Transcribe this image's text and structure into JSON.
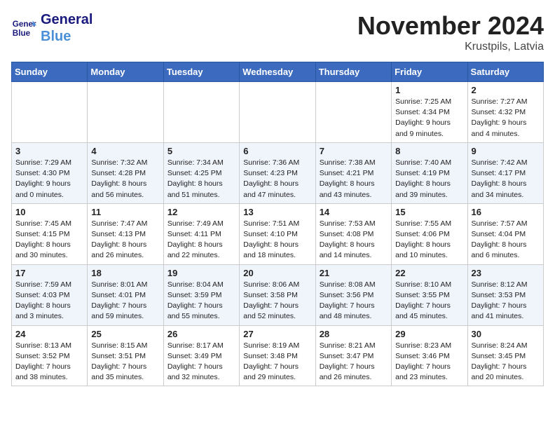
{
  "logo": {
    "line1": "General",
    "line2": "Blue"
  },
  "title": "November 2024",
  "location": "Krustpils, Latvia",
  "weekdays": [
    "Sunday",
    "Monday",
    "Tuesday",
    "Wednesday",
    "Thursday",
    "Friday",
    "Saturday"
  ],
  "rows": [
    [
      {
        "day": "",
        "info": ""
      },
      {
        "day": "",
        "info": ""
      },
      {
        "day": "",
        "info": ""
      },
      {
        "day": "",
        "info": ""
      },
      {
        "day": "",
        "info": ""
      },
      {
        "day": "1",
        "info": "Sunrise: 7:25 AM\nSunset: 4:34 PM\nDaylight: 9 hours and 9 minutes."
      },
      {
        "day": "2",
        "info": "Sunrise: 7:27 AM\nSunset: 4:32 PM\nDaylight: 9 hours and 4 minutes."
      }
    ],
    [
      {
        "day": "3",
        "info": "Sunrise: 7:29 AM\nSunset: 4:30 PM\nDaylight: 9 hours and 0 minutes."
      },
      {
        "day": "4",
        "info": "Sunrise: 7:32 AM\nSunset: 4:28 PM\nDaylight: 8 hours and 56 minutes."
      },
      {
        "day": "5",
        "info": "Sunrise: 7:34 AM\nSunset: 4:25 PM\nDaylight: 8 hours and 51 minutes."
      },
      {
        "day": "6",
        "info": "Sunrise: 7:36 AM\nSunset: 4:23 PM\nDaylight: 8 hours and 47 minutes."
      },
      {
        "day": "7",
        "info": "Sunrise: 7:38 AM\nSunset: 4:21 PM\nDaylight: 8 hours and 43 minutes."
      },
      {
        "day": "8",
        "info": "Sunrise: 7:40 AM\nSunset: 4:19 PM\nDaylight: 8 hours and 39 minutes."
      },
      {
        "day": "9",
        "info": "Sunrise: 7:42 AM\nSunset: 4:17 PM\nDaylight: 8 hours and 34 minutes."
      }
    ],
    [
      {
        "day": "10",
        "info": "Sunrise: 7:45 AM\nSunset: 4:15 PM\nDaylight: 8 hours and 30 minutes."
      },
      {
        "day": "11",
        "info": "Sunrise: 7:47 AM\nSunset: 4:13 PM\nDaylight: 8 hours and 26 minutes."
      },
      {
        "day": "12",
        "info": "Sunrise: 7:49 AM\nSunset: 4:11 PM\nDaylight: 8 hours and 22 minutes."
      },
      {
        "day": "13",
        "info": "Sunrise: 7:51 AM\nSunset: 4:10 PM\nDaylight: 8 hours and 18 minutes."
      },
      {
        "day": "14",
        "info": "Sunrise: 7:53 AM\nSunset: 4:08 PM\nDaylight: 8 hours and 14 minutes."
      },
      {
        "day": "15",
        "info": "Sunrise: 7:55 AM\nSunset: 4:06 PM\nDaylight: 8 hours and 10 minutes."
      },
      {
        "day": "16",
        "info": "Sunrise: 7:57 AM\nSunset: 4:04 PM\nDaylight: 8 hours and 6 minutes."
      }
    ],
    [
      {
        "day": "17",
        "info": "Sunrise: 7:59 AM\nSunset: 4:03 PM\nDaylight: 8 hours and 3 minutes."
      },
      {
        "day": "18",
        "info": "Sunrise: 8:01 AM\nSunset: 4:01 PM\nDaylight: 7 hours and 59 minutes."
      },
      {
        "day": "19",
        "info": "Sunrise: 8:04 AM\nSunset: 3:59 PM\nDaylight: 7 hours and 55 minutes."
      },
      {
        "day": "20",
        "info": "Sunrise: 8:06 AM\nSunset: 3:58 PM\nDaylight: 7 hours and 52 minutes."
      },
      {
        "day": "21",
        "info": "Sunrise: 8:08 AM\nSunset: 3:56 PM\nDaylight: 7 hours and 48 minutes."
      },
      {
        "day": "22",
        "info": "Sunrise: 8:10 AM\nSunset: 3:55 PM\nDaylight: 7 hours and 45 minutes."
      },
      {
        "day": "23",
        "info": "Sunrise: 8:12 AM\nSunset: 3:53 PM\nDaylight: 7 hours and 41 minutes."
      }
    ],
    [
      {
        "day": "24",
        "info": "Sunrise: 8:13 AM\nSunset: 3:52 PM\nDaylight: 7 hours and 38 minutes."
      },
      {
        "day": "25",
        "info": "Sunrise: 8:15 AM\nSunset: 3:51 PM\nDaylight: 7 hours and 35 minutes."
      },
      {
        "day": "26",
        "info": "Sunrise: 8:17 AM\nSunset: 3:49 PM\nDaylight: 7 hours and 32 minutes."
      },
      {
        "day": "27",
        "info": "Sunrise: 8:19 AM\nSunset: 3:48 PM\nDaylight: 7 hours and 29 minutes."
      },
      {
        "day": "28",
        "info": "Sunrise: 8:21 AM\nSunset: 3:47 PM\nDaylight: 7 hours and 26 minutes."
      },
      {
        "day": "29",
        "info": "Sunrise: 8:23 AM\nSunset: 3:46 PM\nDaylight: 7 hours and 23 minutes."
      },
      {
        "day": "30",
        "info": "Sunrise: 8:24 AM\nSunset: 3:45 PM\nDaylight: 7 hours and 20 minutes."
      }
    ]
  ]
}
